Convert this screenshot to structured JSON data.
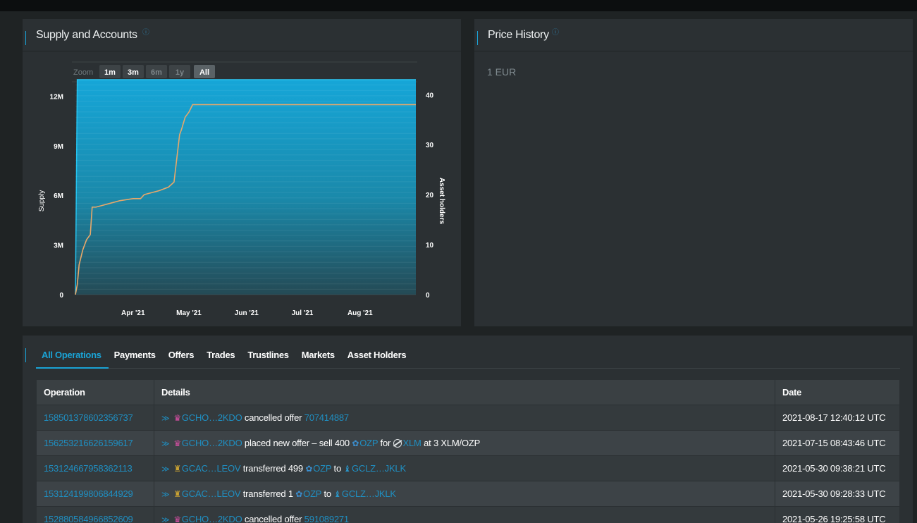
{
  "supply_panel": {
    "title": "Supply and Accounts",
    "info_icon": "info-icon"
  },
  "price_panel": {
    "title": "Price History",
    "price_text": "1 EUR"
  },
  "zoom": {
    "label": "Zoom",
    "buttons": [
      "1m",
      "3m",
      "6m",
      "1y",
      "All"
    ],
    "active": "All"
  },
  "chart_data": {
    "type": "area",
    "x_ticks": [
      "Apr '21",
      "May '21",
      "Jun '21",
      "Jul '21",
      "Aug '21"
    ],
    "y_left_label": "Supply",
    "y_left_ticks": [
      "0",
      "3M",
      "6M",
      "9M",
      "12M"
    ],
    "y_right_label": "Asset holders",
    "y_right_ticks": [
      "0",
      "10",
      "20",
      "30",
      "40"
    ],
    "series": [
      {
        "name": "Supply",
        "type": "area",
        "color": "#1aa3d6",
        "x": [
          "2021-03-01",
          "2021-03-02",
          "2021-08-31"
        ],
        "values": [
          0,
          13000000,
          13000000
        ]
      },
      {
        "name": "Asset holders",
        "type": "line",
        "color": "#e8a86a",
        "x": [
          "2021-03-01",
          "2021-03-02",
          "2021-03-03",
          "2021-03-05",
          "2021-03-07",
          "2021-03-09",
          "2021-03-10",
          "2021-03-12",
          "2021-03-15",
          "2021-03-20",
          "2021-03-25",
          "2021-04-01",
          "2021-04-05",
          "2021-04-07",
          "2021-04-10",
          "2021-04-15",
          "2021-04-20",
          "2021-04-23",
          "2021-04-26",
          "2021-04-27",
          "2021-04-29",
          "2021-05-01",
          "2021-05-03",
          "2021-05-05",
          "2021-05-10",
          "2021-08-31"
        ],
        "values": [
          0,
          2,
          6,
          9,
          11,
          12,
          17.5,
          17.5,
          17.8,
          18.3,
          18.8,
          19.2,
          19.2,
          20,
          20.3,
          20.8,
          21.5,
          22.5,
          32,
          33,
          35.5,
          36.5,
          38,
          38,
          38,
          38
        ]
      }
    ],
    "ylim_left": [
      0,
      13000000
    ],
    "ylim_right": [
      0,
      43
    ],
    "grid": true
  },
  "tabs": {
    "items": [
      "All Operations",
      "Payments",
      "Offers",
      "Trades",
      "Trustlines",
      "Markets",
      "Asset Holders"
    ],
    "active": "All Operations"
  },
  "table": {
    "headers": [
      "Operation",
      "Details",
      "Date"
    ],
    "rows": [
      {
        "op": "158501378602356737",
        "account": "GCHO…2KDO",
        "account_icon": "pink",
        "action": "cancelled offer",
        "ref": "707414887",
        "date": "2021-08-17 12:40:12 UTC"
      },
      {
        "op": "156253216626159617",
        "account": "GCHO…2KDO",
        "account_icon": "pink",
        "action": "placed new offer – sell 400",
        "asset1": "OZP",
        "mid": "for",
        "asset2": "XLM",
        "tail": "at 3 XLM/OZP",
        "date": "2021-07-15 08:43:46 UTC"
      },
      {
        "op": "153124667958362113",
        "account": "GCAC…LEOV",
        "account_icon": "gold",
        "action": "transferred 499",
        "asset1": "OZP",
        "mid": "to",
        "dest": "GCLZ…JKLK",
        "date": "2021-05-30 09:38:21 UTC"
      },
      {
        "op": "153124199806844929",
        "account": "GCAC…LEOV",
        "account_icon": "gold",
        "action": "transferred 1",
        "asset1": "OZP",
        "mid": "to",
        "dest": "GCLZ…JKLK",
        "date": "2021-05-30 09:28:33 UTC"
      },
      {
        "op": "152880584966852609",
        "account": "GCHO…2KDO",
        "account_icon": "pink",
        "action": "cancelled offer",
        "ref": "591089271",
        "date": "2021-05-26 19:25:58 UTC"
      }
    ]
  }
}
